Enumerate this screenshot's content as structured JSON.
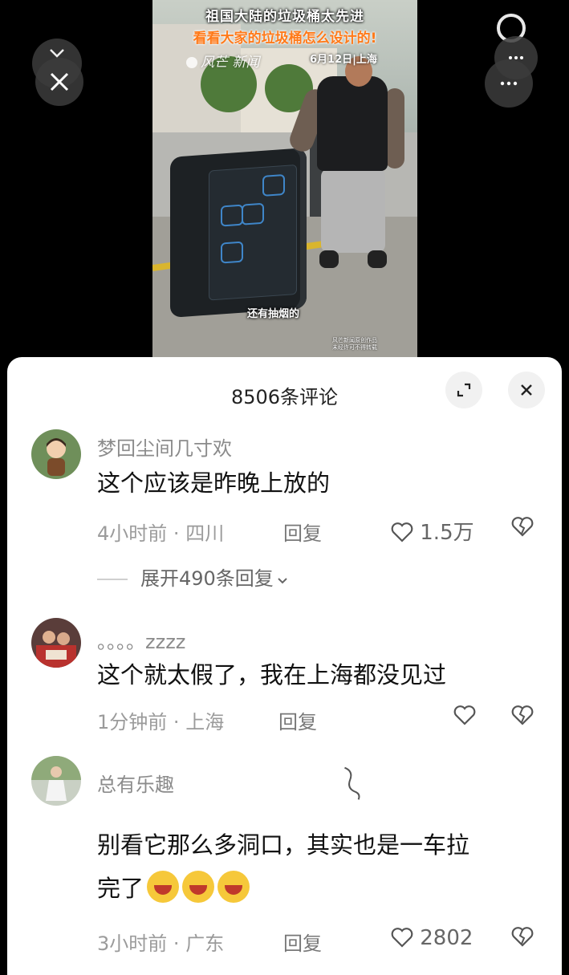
{
  "video": {
    "headline_line1": "祖国大陆的垃圾桶太先进",
    "headline_line2": "看看大家的垃圾桶怎么设计的!",
    "brand": "风芒 新闻",
    "date_location": "6月12日|上海",
    "subtitle": "还有抽烟的",
    "watermark_line1": "风芒新闻原创作品",
    "watermark_line2": "未经许可不得转载"
  },
  "overlay": {
    "collapse_icon": "chevron-down-icon",
    "close_icon": "close-icon",
    "more_icon": "more-dots-icon"
  },
  "comments_panel": {
    "title": "8506条评论",
    "expand_icon": "expand-icon",
    "close_icon": "close-icon"
  },
  "comments": [
    {
      "user": "梦回尘间几寸欢",
      "text": "这个应该是昨晚上放的",
      "time": "4小时前",
      "location": "四川",
      "reply_label": "回复",
      "likes": "1.5万",
      "expand_label": "展开490条回复"
    },
    {
      "user": "。。。。zzzz",
      "text": "这个就太假了，我在上海都没见过",
      "time": "1分钟前",
      "location": "上海",
      "reply_label": "回复",
      "likes": ""
    },
    {
      "user": "总有乐趣",
      "text_line1": "别看它那么多洞口，其实也是一车拉",
      "text_line2": "完了",
      "time": "3小时前",
      "location": "广东",
      "reply_label": "回复",
      "likes": "2802"
    }
  ],
  "meta_separator": "·"
}
